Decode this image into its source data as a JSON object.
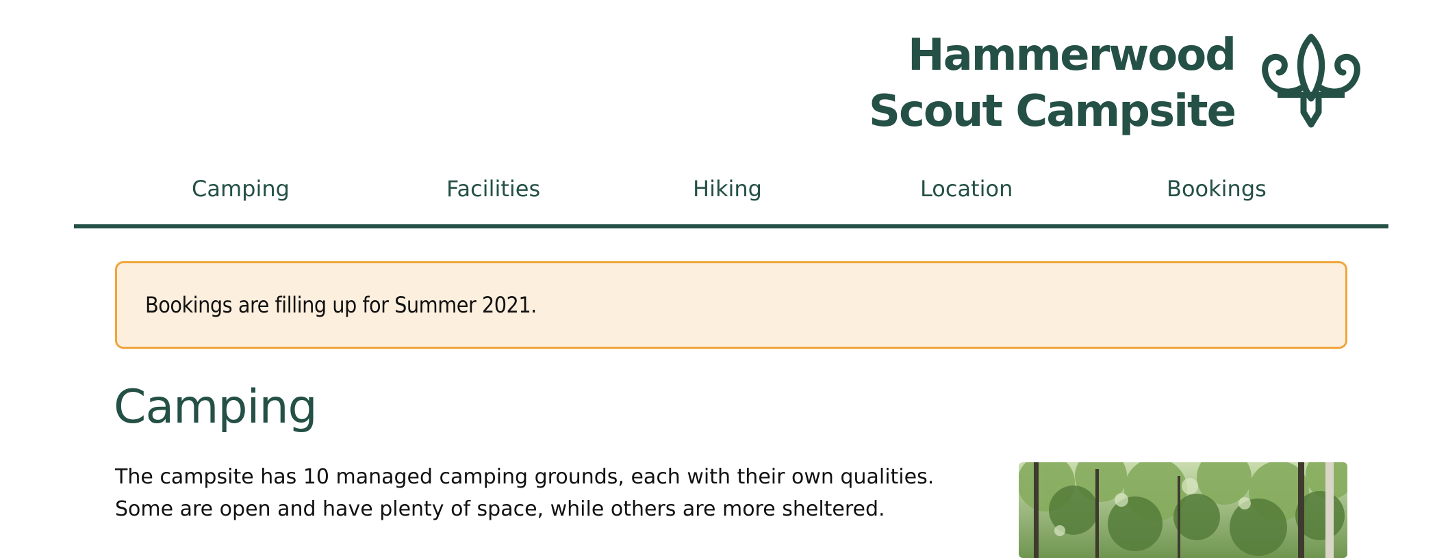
{
  "site": {
    "title_line1": "Hammerwood",
    "title_line2": "Scout Campsite",
    "logo_icon": "scout-fleur-de-lis-icon",
    "brand_color": "#245046"
  },
  "nav": {
    "items": [
      {
        "label": "Camping"
      },
      {
        "label": "Facilities"
      },
      {
        "label": "Hiking"
      },
      {
        "label": "Location"
      },
      {
        "label": "Bookings"
      }
    ]
  },
  "notice": {
    "text": "Bookings are filling up for Summer 2021.",
    "background": "#fdefdd",
    "border": "#f0a53b"
  },
  "main": {
    "heading": "Camping",
    "paragraph_line1": "The campsite has 10 managed camping grounds, each with their own qualities.",
    "paragraph_line2": "Some are open and have plenty of space, while others are more sheltered."
  }
}
